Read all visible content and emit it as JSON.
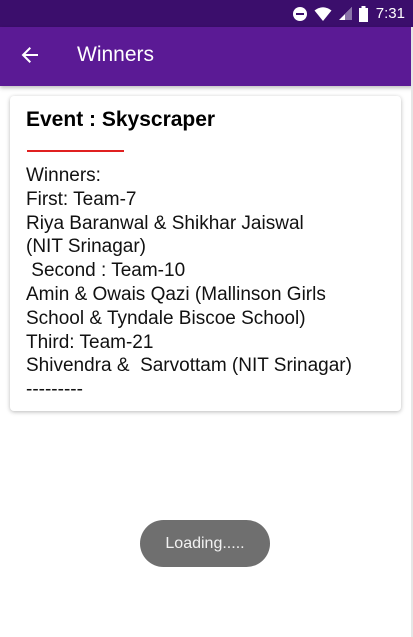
{
  "status_bar": {
    "time": "7:31",
    "icons": [
      "do-not-disturb-icon",
      "wifi-icon",
      "cellular-signal-icon",
      "battery-icon"
    ]
  },
  "app_bar": {
    "title": "Winners",
    "back_icon": "arrow-back-icon",
    "color": "#5b1a95"
  },
  "card": {
    "event_title": "Event : Skyscraper",
    "accent_color": "#e02020",
    "winners_text": "Winners:\nFirst: Team-7\nRiya Baranwal & Shikhar Jaiswal\n(NIT Srinagar)\n Second : Team-10\nAmin & Owais Qazi (Mallinson Girls\nSchool & Tyndale Biscoe School)\nThird: Team-21\nShivendra &  Sarvottam (NIT Srinagar)\n---------"
  },
  "toast": {
    "text": "Loading....."
  }
}
